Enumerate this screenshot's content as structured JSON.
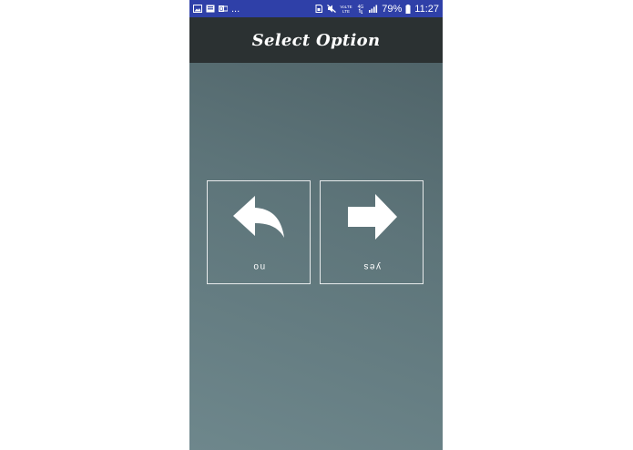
{
  "status_bar": {
    "left_icons": [
      "image-icon",
      "gallery-icon",
      "outlook-icon"
    ],
    "more": "...",
    "right_icons": [
      "sim-icon",
      "mute-icon",
      "volte-icon",
      "4g-icon",
      "signal-icon"
    ],
    "volte": "VoLTE",
    "network": "4G",
    "battery": "79%",
    "time": "11:27"
  },
  "app_bar": {
    "title": "Select Option"
  },
  "options": [
    {
      "label": "no",
      "icon": "reply-arrow-icon"
    },
    {
      "label": "yes",
      "icon": "right-arrow-icon"
    }
  ],
  "colors": {
    "status_bar": "#2f40a8",
    "app_bar": "#2b3132",
    "background_top": "#4b5e63",
    "background_bottom": "#6e878c"
  }
}
